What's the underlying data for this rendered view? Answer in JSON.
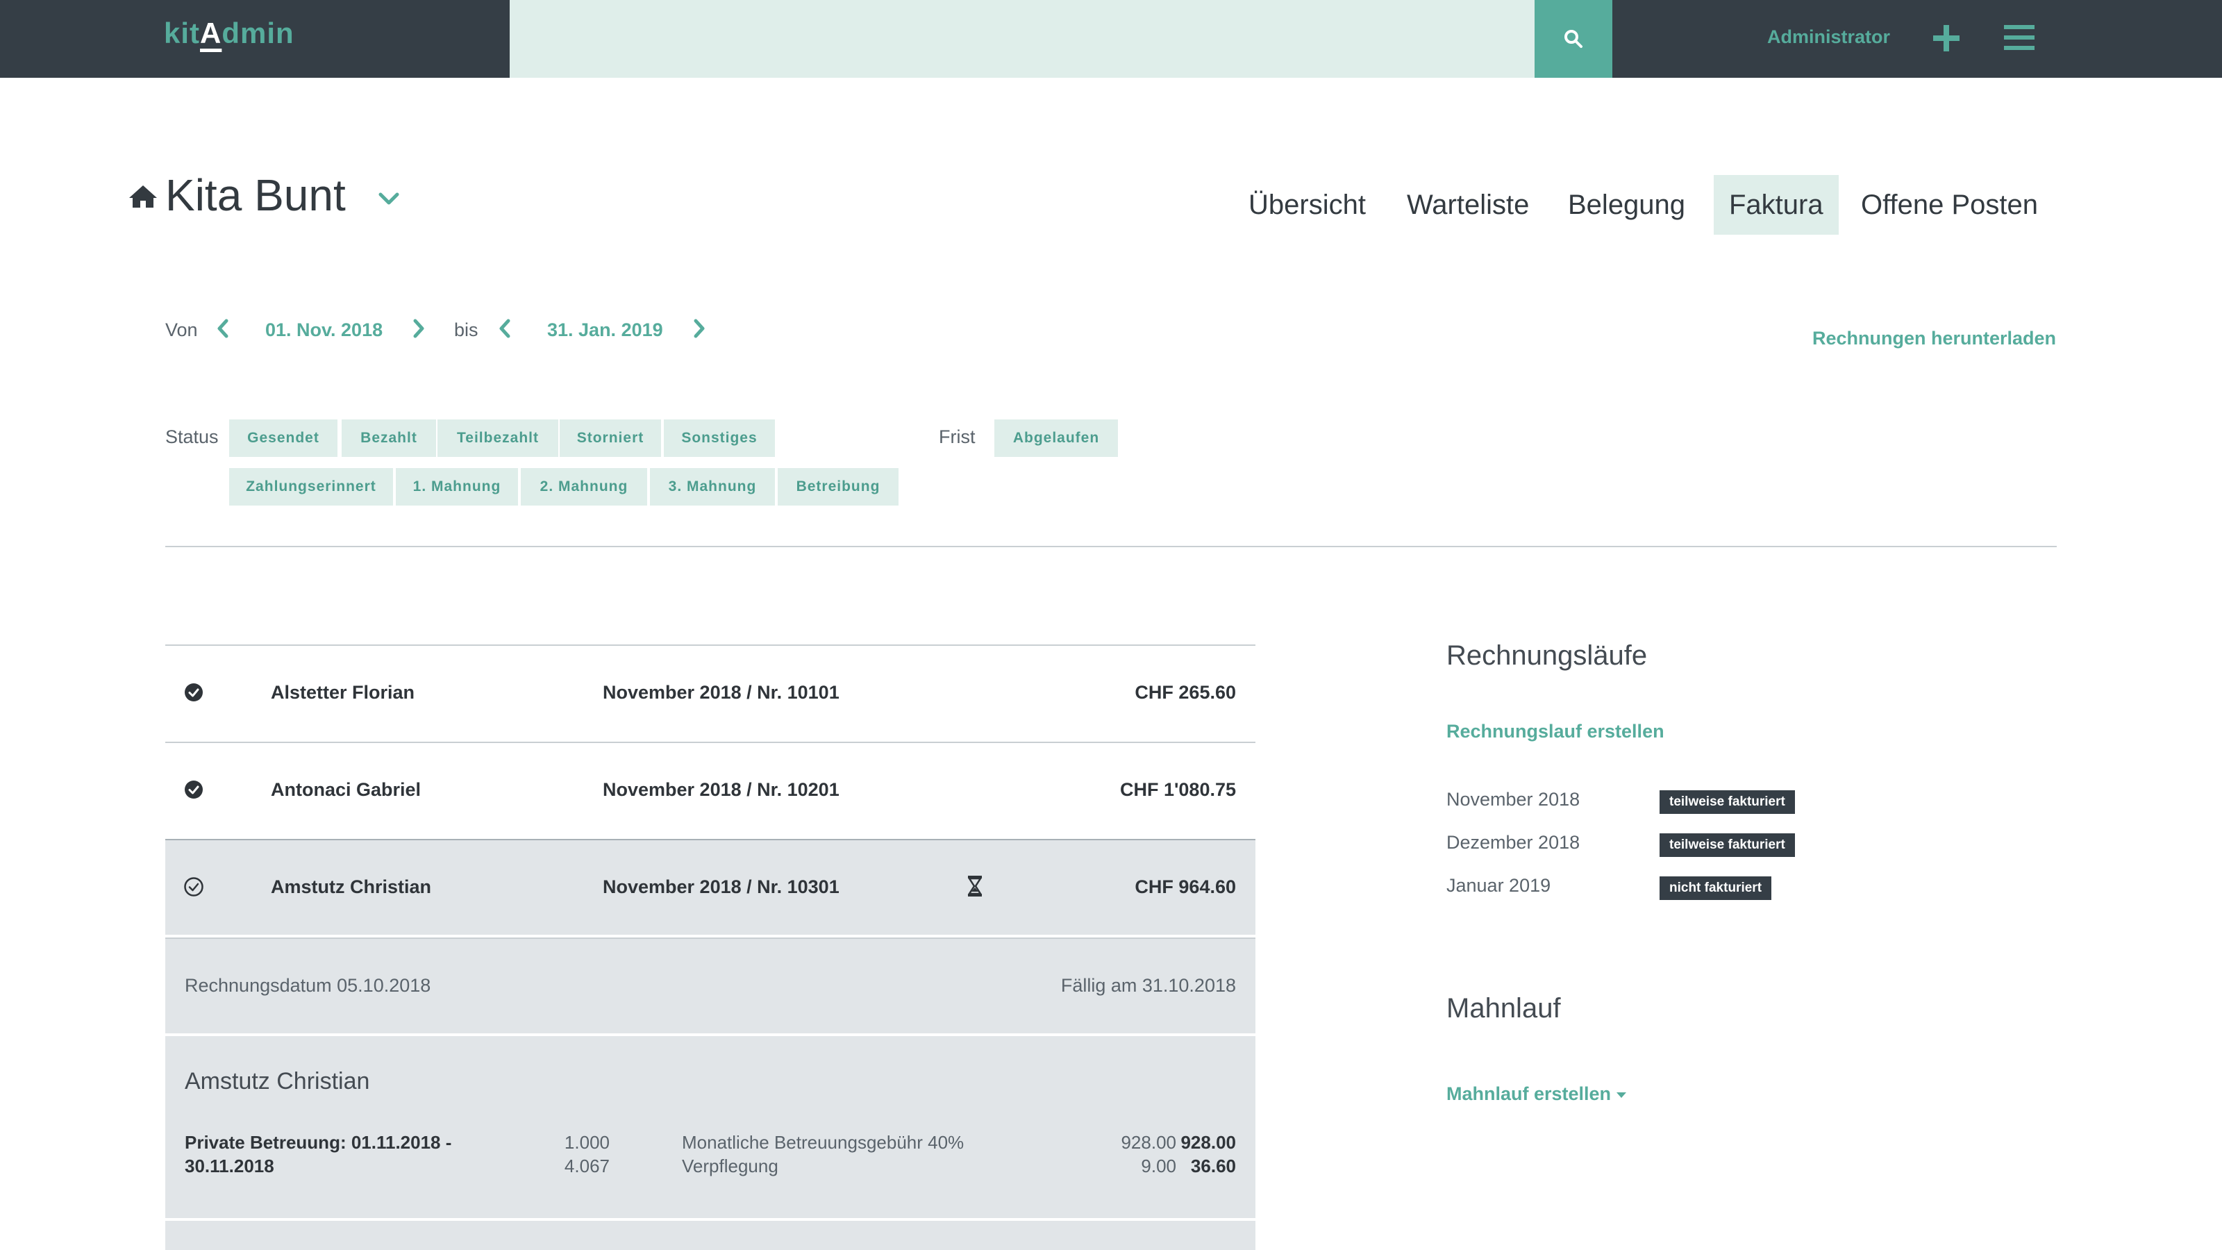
{
  "topbar": {
    "logo_prefix": "kit",
    "logo_mid": "A",
    "logo_suffix": "dmin",
    "search_placeholder": "",
    "admin_label": "Administrator"
  },
  "header": {
    "kita_name": "Kita Bunt",
    "tabs": [
      {
        "label": "Übersicht",
        "active": false
      },
      {
        "label": "Warteliste",
        "active": false
      },
      {
        "label": "Belegung",
        "active": false
      },
      {
        "label": "Faktura",
        "active": true
      },
      {
        "label": "Offene Posten",
        "active": false
      }
    ]
  },
  "filters": {
    "von_label": "Von",
    "von_date": "01. Nov. 2018",
    "bis_label": "bis",
    "bis_date": "31. Jan. 2019",
    "download_label": "Rechnungen herunterladen",
    "status_label": "Status",
    "status_row1": [
      "Gesendet",
      "Bezahlt",
      "Teilbezahlt",
      "Storniert",
      "Sonstiges"
    ],
    "status_row2": [
      "Zahlungserinnert",
      "1. Mahnung",
      "2. Mahnung",
      "3. Mahnung",
      "Betreibung"
    ],
    "frist_label": "Frist",
    "frist_options": [
      "Abgelaufen"
    ]
  },
  "invoices": [
    {
      "name": "Alstetter Florian",
      "period": "November 2018 / Nr. 10101",
      "amount": "CHF 265.60",
      "status_icon": "check-filled-icon"
    },
    {
      "name": "Antonaci Gabriel",
      "period": "November 2018 / Nr. 10201",
      "amount": "CHF 1'080.75",
      "status_icon": "check-filled-icon"
    },
    {
      "name": "Amstutz Christian",
      "period": "November 2018 / Nr. 10301",
      "amount": "CHF 964.60",
      "status_icon": "check-outline-icon",
      "pending_icon": "hourglass-icon"
    }
  ],
  "detail": {
    "invoice_date": "Rechnungsdatum 05.10.2018",
    "due_date": "Fällig am 31.10.2018",
    "child_name": "Amstutz Christian",
    "position_desc": "Private Betreuung: 01.11.2018 - 30.11.2018",
    "lines": [
      {
        "qty": "1.000",
        "item": "Monatliche Betreuungsgebühr 40%",
        "price": "928.00",
        "total": "928.00"
      },
      {
        "qty": "4.067",
        "item": "Verpflegung",
        "price": "9.00",
        "total": "36.60"
      }
    ]
  },
  "sidebar": {
    "runs_title": "Rechnungsläufe",
    "create_run": "Rechnungslauf erstellen",
    "runs": [
      {
        "month": "November 2018",
        "status": "teilweise fakturiert"
      },
      {
        "month": "Dezember 2018",
        "status": "teilweise fakturiert"
      },
      {
        "month": "Januar 2019",
        "status": "nicht fakturiert"
      }
    ],
    "dunning_title": "Mahnlauf",
    "create_dunning": "Mahnlauf erstellen"
  },
  "colors": {
    "topbar": "#353e46",
    "accent": "#56ac9c",
    "pill_bg": "#dfeeea",
    "selected_row": "#e1e5e8"
  }
}
